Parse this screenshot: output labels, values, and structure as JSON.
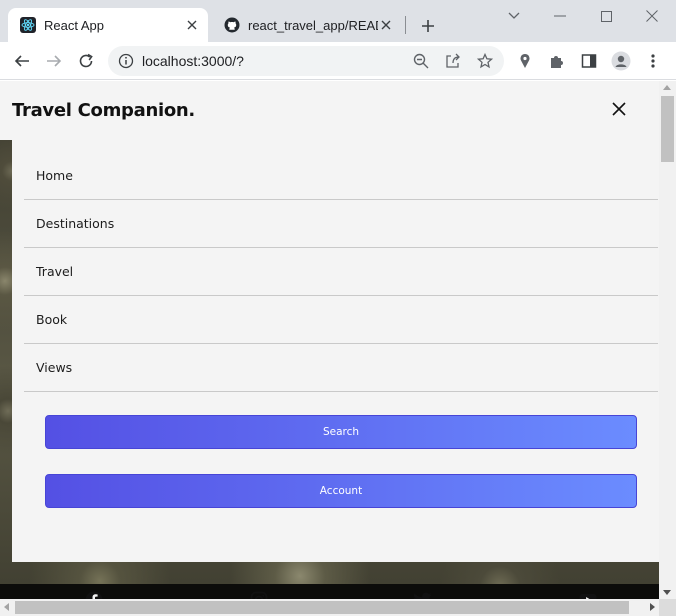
{
  "browser": {
    "tabs": [
      {
        "title": "React App",
        "icon": "react-logo-icon",
        "active": true
      },
      {
        "title": "react_travel_app/README.m",
        "icon": "github-icon",
        "active": false
      }
    ],
    "url": "localhost:3000/?"
  },
  "site": {
    "brand": "Travel Companion.",
    "menu": [
      {
        "label": "Home"
      },
      {
        "label": "Destinations"
      },
      {
        "label": "Travel"
      },
      {
        "label": "Book"
      },
      {
        "label": "Views"
      }
    ],
    "search_label": "Search",
    "account_label": "Account",
    "social": [
      "facebook-icon",
      "instagram-icon",
      "twitter-icon",
      "youtube-icon"
    ]
  },
  "colors": {
    "button_gradient_start": "#5450e4",
    "button_gradient_end": "#6b8cff",
    "panel_bg": "#f4f4f4"
  }
}
